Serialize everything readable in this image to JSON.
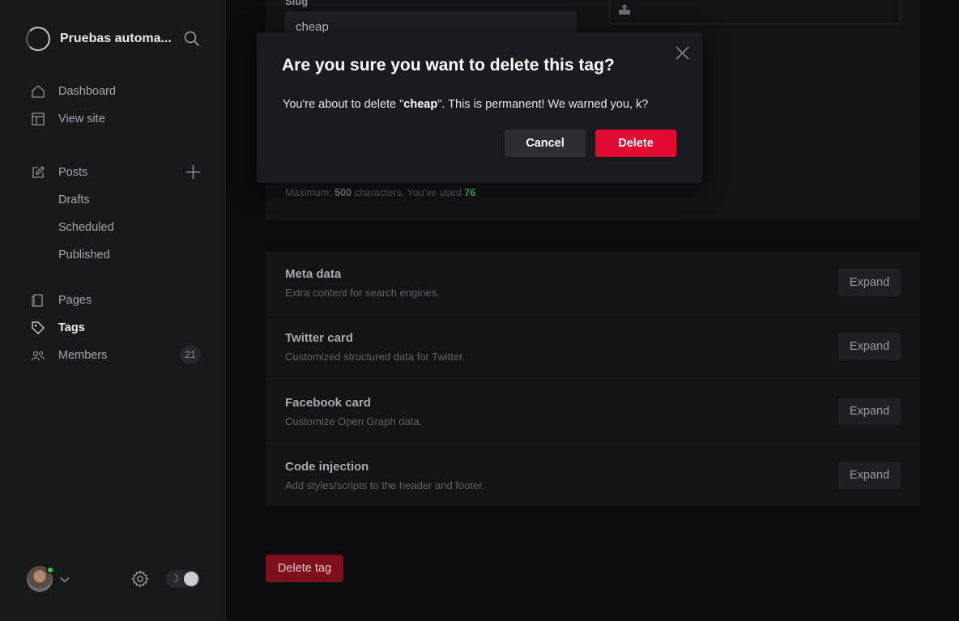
{
  "sidebar": {
    "site_name": "Pruebas automa...",
    "nav": {
      "dashboard": "Dashboard",
      "view_site": "View site",
      "posts": "Posts",
      "drafts": "Drafts",
      "scheduled": "Scheduled",
      "published": "Published",
      "pages": "Pages",
      "tags": "Tags",
      "members": "Members",
      "members_count": "21"
    }
  },
  "form": {
    "slug_label": "Slug",
    "slug_value": "cheap",
    "hint_prefix": "Maximum: ",
    "hint_max": "500",
    "hint_mid": " characters. You've used ",
    "hint_used": "76"
  },
  "sections": [
    {
      "title": "Meta data",
      "desc": "Extra content for search engines.",
      "button": "Expand"
    },
    {
      "title": "Twitter card",
      "desc": "Customized structured data for Twitter.",
      "button": "Expand"
    },
    {
      "title": "Facebook card",
      "desc": "Customize Open Graph data.",
      "button": "Expand"
    },
    {
      "title": "Code injection",
      "desc": "Add styles/scripts to the header and footer.",
      "button": "Expand"
    }
  ],
  "delete_tag_label": "Delete tag",
  "modal": {
    "title": "Are you sure you want to delete this tag?",
    "body_prefix": "You're about to delete \"",
    "body_tag": "cheap",
    "body_suffix": "\". This is permanent! We warned you, k?",
    "cancel_label": "Cancel",
    "delete_label": "Delete"
  },
  "colors": {
    "accent_danger": "#e10a31",
    "success": "#30cf43",
    "background": "#0b0c0d",
    "sidebar": "#18191b"
  },
  "icons": [
    "logo-icon",
    "search-icon",
    "home-icon",
    "layout-icon",
    "edit-icon",
    "plus-icon",
    "page-icon",
    "tag-icon",
    "users-icon",
    "chevron-down-icon",
    "gear-icon",
    "moon-icon",
    "upload-icon",
    "close-icon"
  ]
}
